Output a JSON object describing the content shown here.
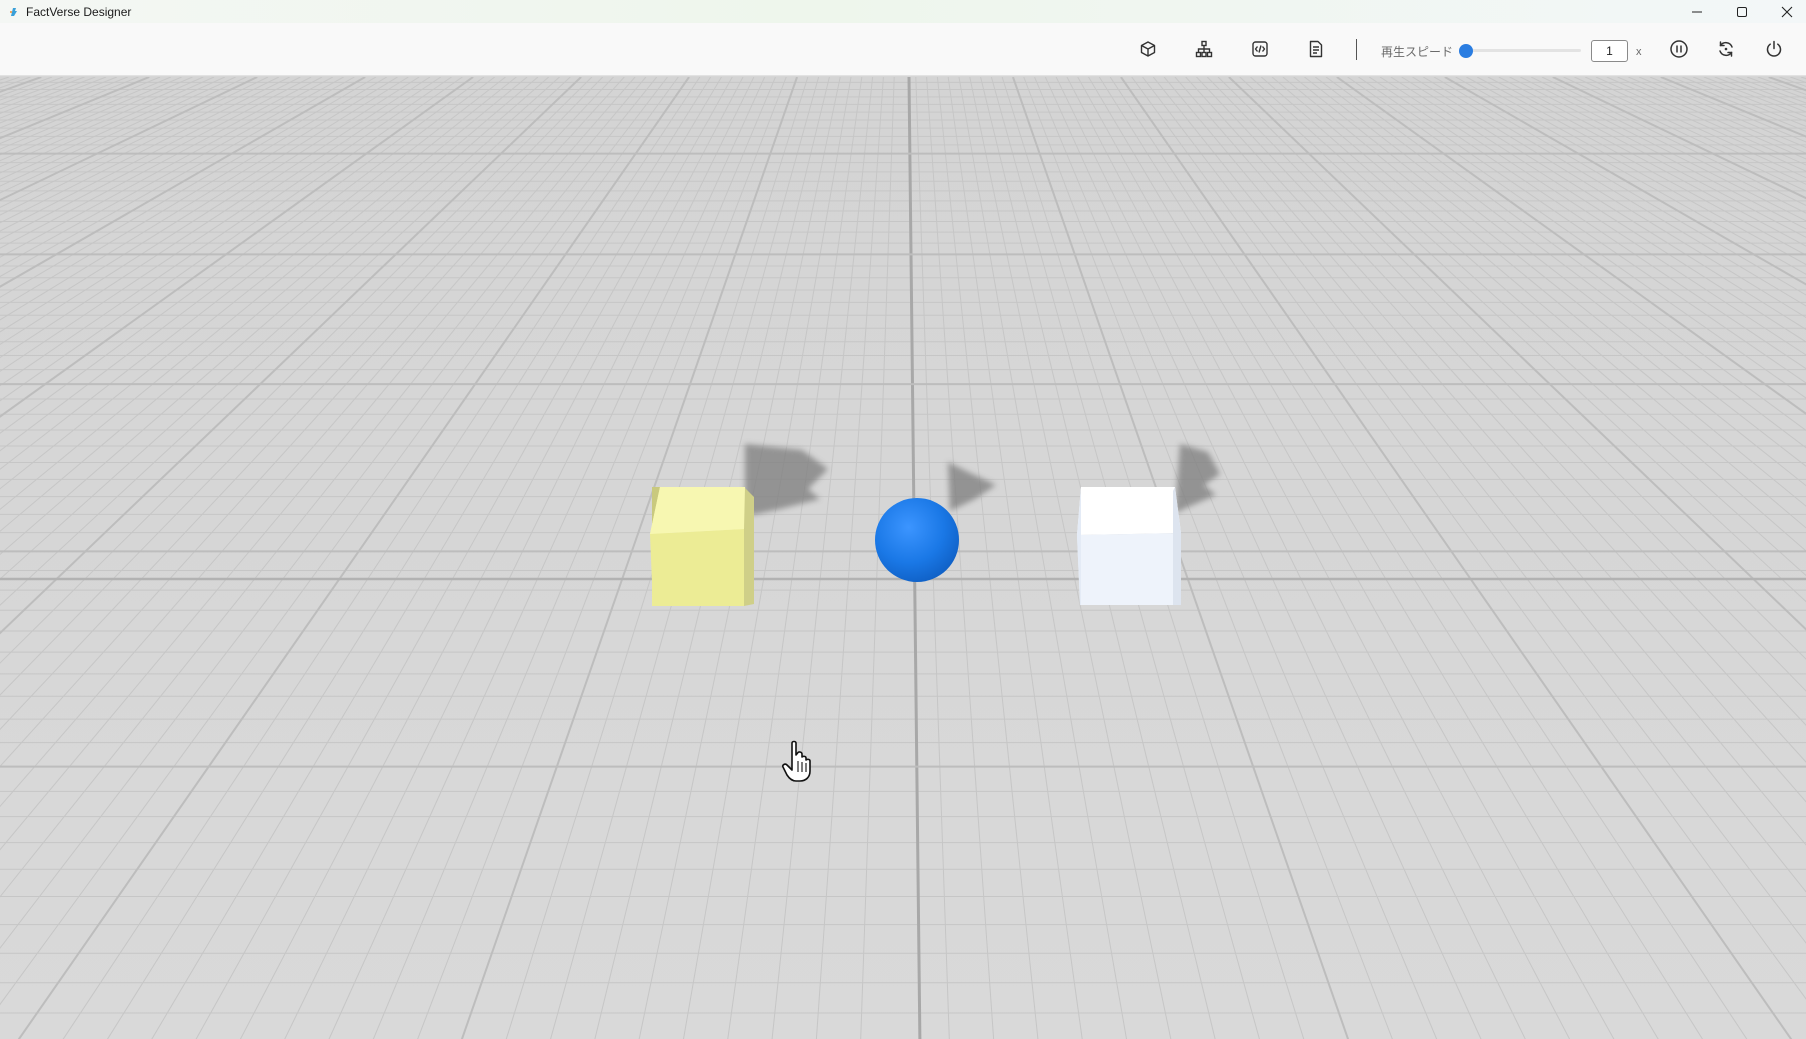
{
  "window": {
    "title": "FactVerse Designer",
    "icon": "factverse-logo-icon"
  },
  "window_controls": {
    "minimize": "minimize-icon",
    "maximize": "maximize-icon",
    "close": "close-icon"
  },
  "toolbar": {
    "buttons": [
      {
        "name": "model-library-button",
        "icon": "cube-icon"
      },
      {
        "name": "hierarchy-button",
        "icon": "hierarchy-icon"
      },
      {
        "name": "script-button",
        "icon": "code-icon"
      },
      {
        "name": "document-button",
        "icon": "document-icon"
      }
    ],
    "playback_speed_label": "再生スピード",
    "playback_speed_value": "1",
    "playback_speed_fraction": 0.0,
    "playback_speed_unit": "x",
    "actions": [
      {
        "name": "pause-button",
        "icon": "pause-icon"
      },
      {
        "name": "reset-button",
        "icon": "refresh-icon"
      },
      {
        "name": "power-button",
        "icon": "power-icon"
      }
    ]
  },
  "scene": {
    "background_color": "#d6d6d6",
    "grid_line_color": "#c6c6c6",
    "objects": [
      {
        "name": "yellow-cube",
        "shape": "cube",
        "color": "#f3f39a"
      },
      {
        "name": "blue-sphere",
        "shape": "sphere",
        "color": "#1a78e6"
      },
      {
        "name": "white-cube",
        "shape": "cube",
        "color": "#eef3fb"
      }
    ]
  }
}
